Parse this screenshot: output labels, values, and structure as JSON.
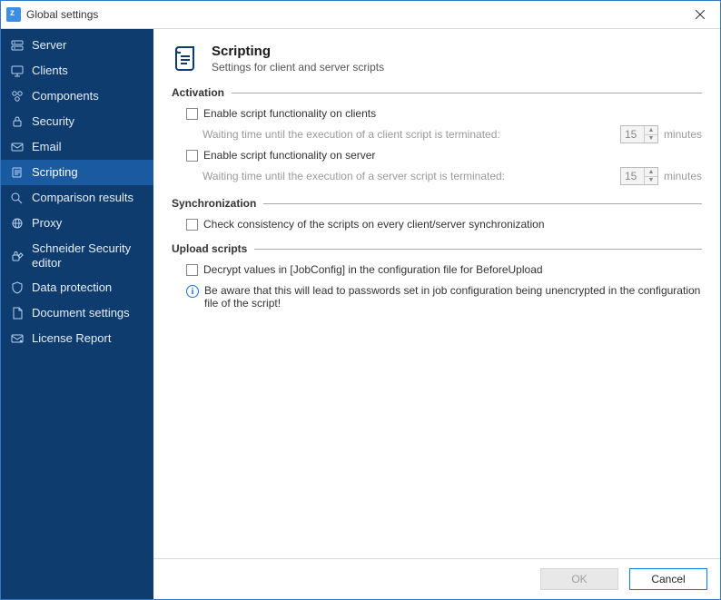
{
  "window": {
    "title": "Global settings"
  },
  "sidebar": {
    "items": [
      {
        "label": "Server"
      },
      {
        "label": "Clients"
      },
      {
        "label": "Components"
      },
      {
        "label": "Security"
      },
      {
        "label": "Email"
      },
      {
        "label": "Scripting"
      },
      {
        "label": "Comparison results"
      },
      {
        "label": "Proxy"
      },
      {
        "label": "Schneider Security editor"
      },
      {
        "label": "Data protection"
      },
      {
        "label": "Document settings"
      },
      {
        "label": "License Report"
      }
    ],
    "selected_index": 5
  },
  "page": {
    "title": "Scripting",
    "subtitle": "Settings for client and server scripts"
  },
  "groups": {
    "activation": {
      "header": "Activation",
      "enable_client": {
        "label": "Enable script functionality on clients",
        "checked": false
      },
      "client_wait": {
        "label": "Waiting time until the execution of a client script is terminated:",
        "value": "15",
        "units": "minutes"
      },
      "enable_server": {
        "label": "Enable script functionality on server",
        "checked": false
      },
      "server_wait": {
        "label": "Waiting time until the execution of a server script is terminated:",
        "value": "15",
        "units": "minutes"
      }
    },
    "synchronization": {
      "header": "Synchronization",
      "check": {
        "label": "Check consistency of the scripts on every client/server synchronization",
        "checked": false
      }
    },
    "upload": {
      "header": "Upload scripts",
      "decrypt": {
        "label": "Decrypt values in [JobConfig] in the configuration file for BeforeUpload",
        "checked": false
      },
      "info": "Be aware that this will lead to passwords set in job configuration being unencrypted in the configuration file of the script!"
    }
  },
  "footer": {
    "ok_label": "OK",
    "cancel_label": "Cancel"
  }
}
